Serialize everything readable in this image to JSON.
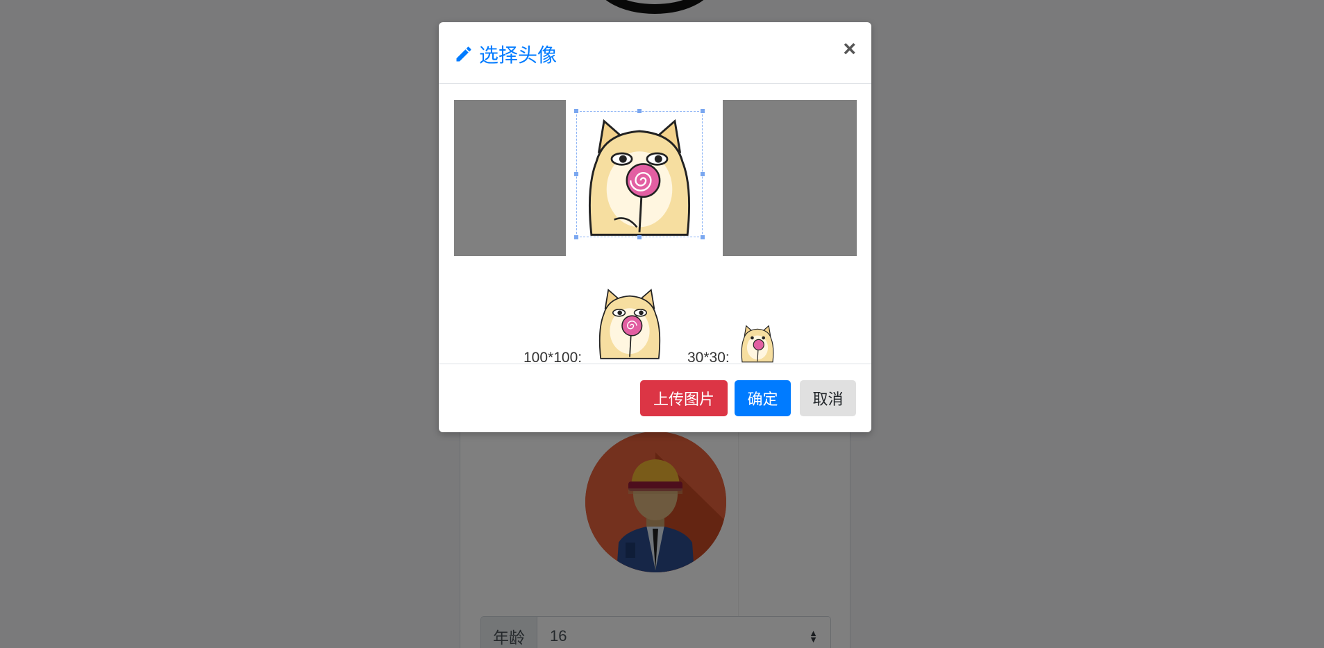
{
  "page": {
    "age_label": "年龄",
    "age_value": "16"
  },
  "modal": {
    "title": "选择头像",
    "close_label": "×",
    "preview_large_label": "100*100:",
    "preview_small_label": "30*30:",
    "upload_button": "上传图片",
    "confirm_button": "确定",
    "cancel_button": "取消"
  },
  "colors": {
    "primary": "#007bff",
    "danger": "#dc3545",
    "secondary": "#e0e0e0"
  },
  "icons": {
    "title_icon": "pencil-icon",
    "close_icon": "close-icon"
  }
}
